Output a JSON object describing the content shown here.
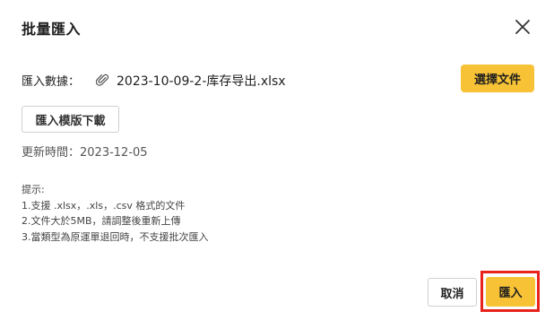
{
  "dialog": {
    "title": "批量匯入",
    "close_icon": "close-icon"
  },
  "file_row": {
    "label": "匯入數據：",
    "attachment_icon": "paperclip-icon",
    "file_name": "2023-10-09-2-库存导出.xlsx",
    "choose_button": "選擇文件"
  },
  "template": {
    "download_button": "匯入模版下載",
    "updated_text": "更新時間：2023-12-05"
  },
  "tips": {
    "heading": "提示:",
    "lines": [
      "1.支援 .xlsx，.xls，.csv 格式的文件",
      "2.文件大於5MB，請調整後重新上傳",
      "3.當類型為原運單退回時，不支援批次匯入"
    ]
  },
  "footer": {
    "cancel_button": "取消",
    "import_button": "匯入"
  },
  "colors": {
    "accent": "#f7c235",
    "highlight": "#e8231c"
  }
}
